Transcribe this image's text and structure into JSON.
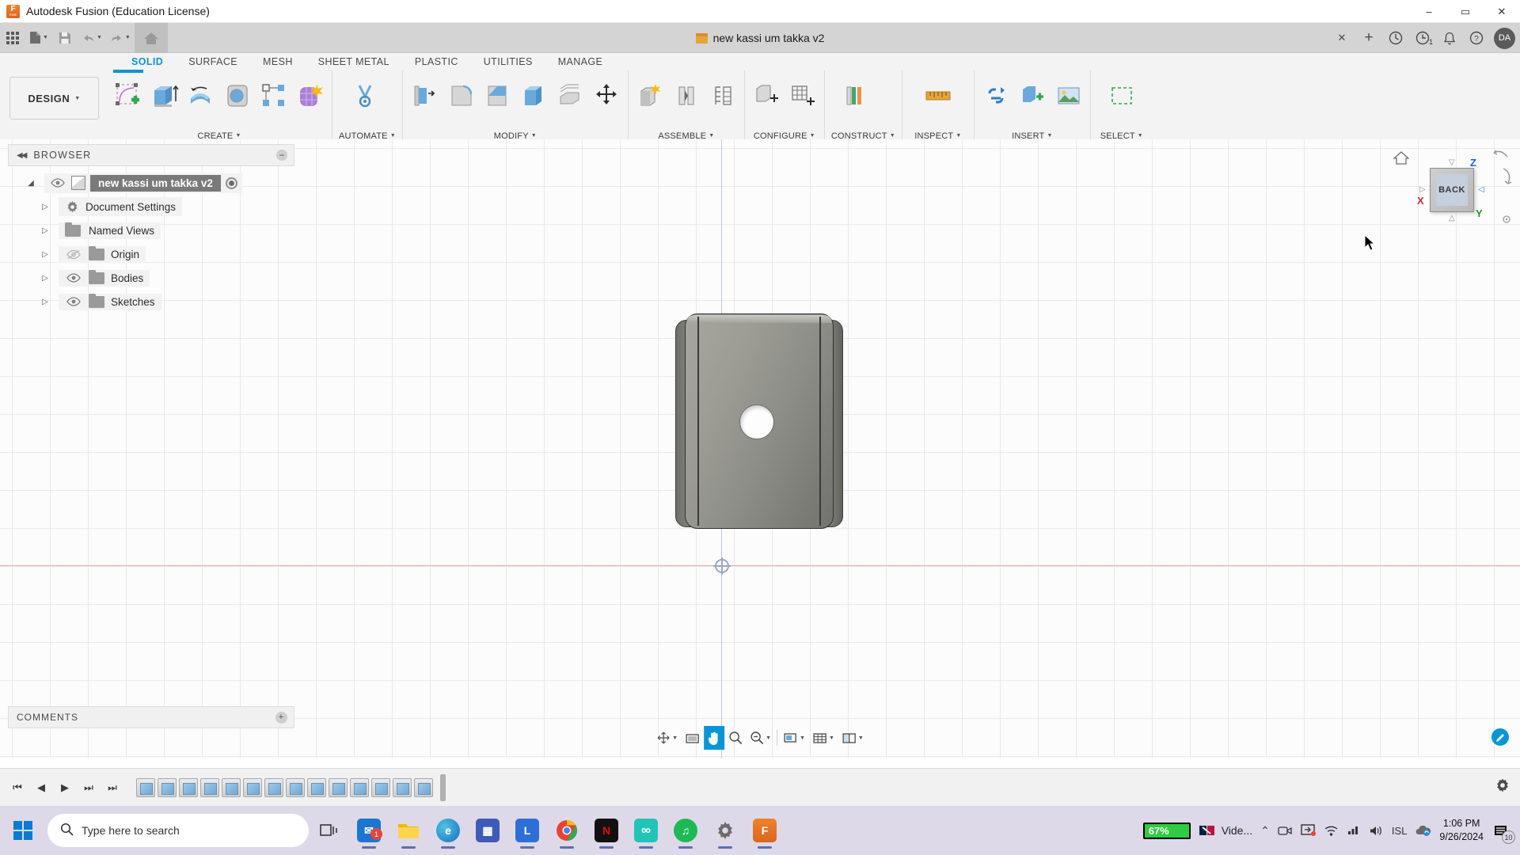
{
  "window": {
    "app_title": "Autodesk Fusion (Education License)",
    "app_icon": "fusion-logo-icon",
    "minimize": "–",
    "maximize": "▭",
    "close": "✕"
  },
  "quick_access": {
    "app_grid": "app-grid-icon",
    "new_file": "new-file-icon",
    "save": "save-icon",
    "undo": "undo-icon",
    "redo": "redo-icon",
    "home": "home-icon",
    "document_title": "new kassi um takka v2",
    "close_doc": "✕",
    "add_tab": "+",
    "extensions": "extensions-icon",
    "job_status": "job-status-icon",
    "job_count": "1",
    "notifications": "bell-icon",
    "help": "help-icon",
    "user_initials": "DA"
  },
  "ribbon": {
    "tabs": [
      {
        "label": "SOLID",
        "active": true
      },
      {
        "label": "SURFACE",
        "active": false
      },
      {
        "label": "MESH",
        "active": false
      },
      {
        "label": "SHEET METAL",
        "active": false
      },
      {
        "label": "PLASTIC",
        "active": false
      },
      {
        "label": "UTILITIES",
        "active": false
      },
      {
        "label": "MANAGE",
        "active": false
      }
    ],
    "workspace_button": "DESIGN",
    "groups": [
      {
        "label": "CREATE",
        "has_dropdown": true,
        "tools": [
          "create-sketch-icon",
          "extrude-icon",
          "revolve-icon",
          "sweep-icon",
          "pattern-icon",
          "form-icon"
        ]
      },
      {
        "label": "AUTOMATE",
        "has_dropdown": true,
        "tools": [
          "automate-icon"
        ]
      },
      {
        "label": "MODIFY",
        "has_dropdown": true,
        "tools": [
          "press-pull-icon",
          "fillet-icon",
          "chamfer-icon",
          "shell-icon",
          "offset-face-icon",
          "move-copy-icon"
        ]
      },
      {
        "label": "ASSEMBLE",
        "has_dropdown": true,
        "tools": [
          "new-component-icon",
          "joint-icon",
          "joint-origin-icon"
        ]
      },
      {
        "label": "CONFIGURE",
        "has_dropdown": true,
        "tools": [
          "configure-design-icon",
          "configuration-table-icon"
        ]
      },
      {
        "label": "CONSTRUCT",
        "has_dropdown": true,
        "tools": [
          "offset-plane-icon",
          "axis-icon"
        ]
      },
      {
        "label": "INSPECT",
        "has_dropdown": true,
        "tools": [
          "measure-icon"
        ]
      },
      {
        "label": "INSERT",
        "has_dropdown": true,
        "tools": [
          "insert-derive-icon",
          "insert-mcmaster-icon",
          "canvas-icon"
        ]
      },
      {
        "label": "SELECT",
        "has_dropdown": true,
        "tools": [
          "select-icon"
        ]
      }
    ]
  },
  "browser": {
    "header": "BROWSER",
    "collapse_icon": "collapse-left-icon",
    "minimize_icon": "−",
    "items": [
      {
        "label": "new kassi um takka v2",
        "icon": "component-icon",
        "selected": true,
        "has_eye": true,
        "has_radio": true,
        "indent": 0,
        "expander": "◢"
      },
      {
        "label": "Document Settings",
        "icon": "gear-icon",
        "has_eye": false,
        "indent": 1,
        "expander": "▷"
      },
      {
        "label": "Named Views",
        "icon": "folder-icon",
        "has_eye": false,
        "indent": 1,
        "expander": "▷"
      },
      {
        "label": "Origin",
        "icon": "folder-icon",
        "has_eye": true,
        "eye_off": true,
        "indent": 1,
        "expander": "▷"
      },
      {
        "label": "Bodies",
        "icon": "folder-icon",
        "has_eye": true,
        "eye_off": false,
        "indent": 1,
        "expander": "▷"
      },
      {
        "label": "Sketches",
        "icon": "folder-icon",
        "has_eye": true,
        "eye_off": false,
        "indent": 1,
        "expander": "▷"
      }
    ]
  },
  "comments": {
    "label": "COMMENTS",
    "add_icon": "+"
  },
  "viewcube": {
    "face_label": "BACK",
    "home_icon": "home-view-icon",
    "axis_z": "Z",
    "axis_x": "X",
    "axis_y": "Y",
    "arrow_up": "▽",
    "arrow_down": "△",
    "arrow_left": "▷",
    "arrow_right": "◁",
    "orbit_icon": "orbit-arrow-icon",
    "roll_icon": "roll-arrow-icon",
    "options_icon": "viewcube-options-icon"
  },
  "navbar": {
    "items": [
      {
        "icon": "orbit-icon",
        "label": "orbit",
        "dropdown": true,
        "active": false
      },
      {
        "icon": "look-at-icon",
        "label": "look-at",
        "dropdown": false,
        "active": false
      },
      {
        "icon": "pan-icon",
        "label": "pan",
        "dropdown": false,
        "active": true
      },
      {
        "icon": "zoom-icon",
        "label": "zoom",
        "dropdown": false,
        "active": false
      },
      {
        "icon": "zoom-window-icon",
        "label": "zoom-window",
        "dropdown": true,
        "active": false
      },
      {
        "icon": "display-settings-icon",
        "label": "display-settings",
        "dropdown": true,
        "active": false
      },
      {
        "icon": "grid-snap-icon",
        "label": "grid-and-snaps",
        "dropdown": true,
        "active": false
      },
      {
        "icon": "viewports-icon",
        "label": "viewports",
        "dropdown": true,
        "active": false
      }
    ],
    "markup_icon": "markup-pencil-icon"
  },
  "timeline": {
    "playback": [
      "⏮",
      "◀",
      "▶",
      "⏭︎",
      "⏭"
    ],
    "feature_count": 14,
    "marker": "end-of-timeline-marker",
    "settings_icon": "gear-icon"
  },
  "taskbar": {
    "start": "windows-start-icon",
    "search_placeholder": "Type here to search",
    "search_icon": "search-icon",
    "apps": [
      {
        "name": "task-view-icon",
        "glyph": "☰",
        "color": "#2b2b2b",
        "running": false
      },
      {
        "name": "mail-icon",
        "glyph": "✉",
        "color": "#1b76d2",
        "running": true,
        "badge": "1"
      },
      {
        "name": "file-explorer-icon",
        "glyph": "Ὄ1",
        "color": "#f2b705",
        "running": true
      },
      {
        "name": "edge-icon",
        "glyph": "e",
        "color": "#2d8ad1",
        "running": true
      },
      {
        "name": "store-icon",
        "glyph": "▦",
        "color": "#5b6fc4",
        "running": false
      },
      {
        "name": "lightshot-icon",
        "glyph": "L",
        "color": "#2d6fd6",
        "running": true
      },
      {
        "name": "chrome-icon",
        "glyph": "●",
        "color": "#e94335",
        "running": true
      },
      {
        "name": "netflix-icon",
        "glyph": "N",
        "color": "#e50914",
        "running": true
      },
      {
        "name": "infinity-icon",
        "glyph": "∞",
        "color": "#22c4b8",
        "running": true
      },
      {
        "name": "spotify-icon",
        "glyph": "♫",
        "color": "#1db954",
        "running": true
      },
      {
        "name": "settings-icon",
        "glyph": "⚙",
        "color": "#6b6b6b",
        "running": true
      },
      {
        "name": "fusion-icon",
        "glyph": "F",
        "color": "#e8722a",
        "running": true
      }
    ],
    "battery_percent": "67%",
    "media_app": "Vide...",
    "tray_overflow": "⌃",
    "tray_icons": [
      "camera-icon",
      "screen-share-icon",
      "wifi-icon",
      "network-icon",
      "volume-icon"
    ],
    "language": "ISL",
    "onedrive": "onedrive-icon",
    "time": "1:06 PM",
    "date": "9/26/2024",
    "notification_count": "10"
  }
}
